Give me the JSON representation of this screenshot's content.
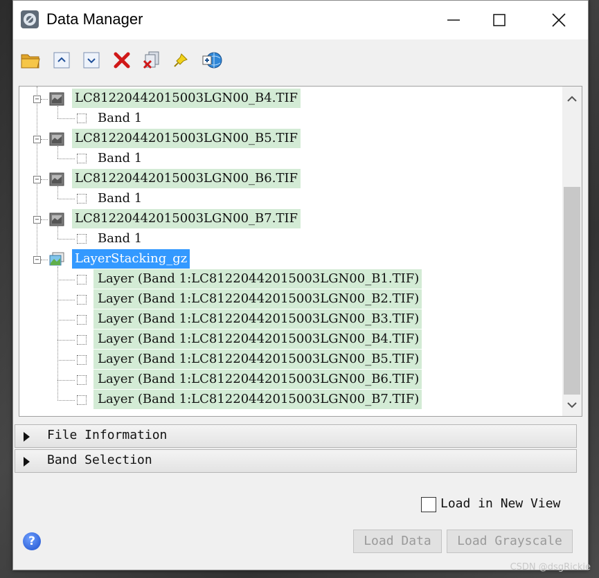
{
  "window": {
    "title": "Data Manager",
    "controls": [
      "minimize",
      "maximize",
      "close"
    ]
  },
  "toolbar": {
    "buttons": [
      {
        "icon": "open-folder-icon"
      },
      {
        "icon": "expand-up-icon"
      },
      {
        "icon": "collapse-down-icon"
      },
      {
        "icon": "remove-red-x-icon"
      },
      {
        "icon": "close-all-files-icon"
      },
      {
        "icon": "pin-icon"
      },
      {
        "icon": "globe-link-icon"
      }
    ]
  },
  "tree": {
    "files": [
      {
        "name": "LC81220442015003LGN00_B4.TIF",
        "bands": [
          "Band 1"
        ]
      },
      {
        "name": "LC81220442015003LGN00_B5.TIF",
        "bands": [
          "Band 1"
        ]
      },
      {
        "name": "LC81220442015003LGN00_B6.TIF",
        "bands": [
          "Band 1"
        ]
      },
      {
        "name": "LC81220442015003LGN00_B7.TIF",
        "bands": [
          "Band 1"
        ]
      }
    ],
    "stack": {
      "name": "LayerStacking_gz",
      "selected": true,
      "layers": [
        "Layer (Band 1:LC81220442015003LGN00_B1.TIF)",
        "Layer (Band 1:LC81220442015003LGN00_B2.TIF)",
        "Layer (Band 1:LC81220442015003LGN00_B3.TIF)",
        "Layer (Band 1:LC81220442015003LGN00_B4.TIF)",
        "Layer (Band 1:LC81220442015003LGN00_B5.TIF)",
        "Layer (Band 1:LC81220442015003LGN00_B6.TIF)",
        "Layer (Band 1:LC81220442015003LGN00_B7.TIF)"
      ]
    }
  },
  "sections": {
    "file_information": "File Information",
    "band_selection": "Band Selection"
  },
  "options": {
    "load_in_new_view": "Load in New View",
    "load_in_new_view_checked": false
  },
  "buttons": {
    "load_data": "Load Data",
    "load_grayscale": "Load Grayscale",
    "help": "?"
  },
  "watermark": "CSDN @dsgRickie",
  "colors": {
    "row_highlight": "#d3ebd5",
    "selection": "#3399ff"
  }
}
